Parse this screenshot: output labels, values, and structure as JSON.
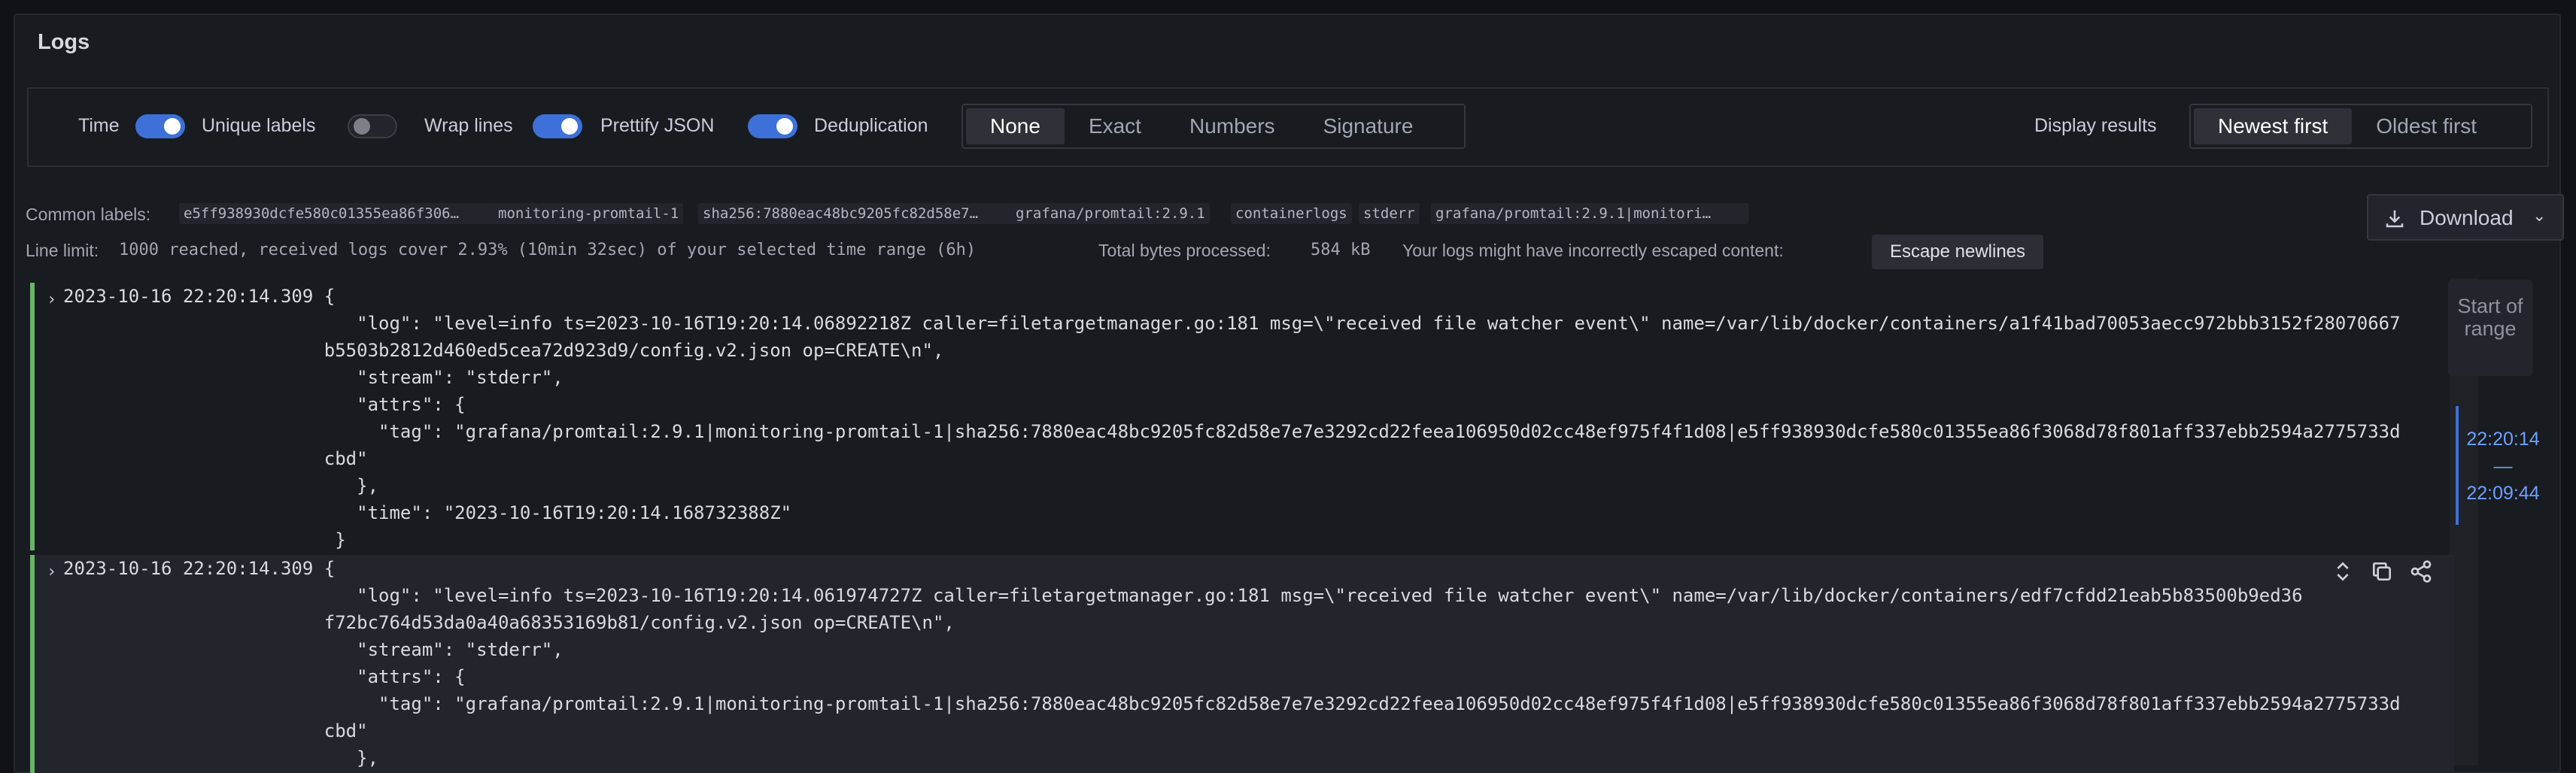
{
  "panel": {
    "title": "Logs"
  },
  "options": {
    "time_label": "Time",
    "unique_labels_label": "Unique labels",
    "wrap_lines_label": "Wrap lines",
    "prettify_json_label": "Prettify JSON",
    "dedup_label": "Deduplication",
    "dedup_options": [
      "None",
      "Exact",
      "Numbers",
      "Signature"
    ],
    "dedup_selected": "None",
    "display_results_label": "Display results",
    "order_options": [
      "Newest first",
      "Oldest first"
    ],
    "order_selected": "Newest first",
    "toggles": {
      "time": true,
      "unique_labels": false,
      "wrap_lines": true,
      "prettify_json": true
    }
  },
  "meta": {
    "common_labels_label": "Common labels:",
    "common_labels": [
      "e5ff938930dcfe580c01355ea86f306…",
      "monitoring-promtail-1",
      "sha256:7880eac48bc9205fc82d58e7…",
      "grafana/promtail:2.9.1",
      "containerlogs",
      "stderr",
      "grafana/promtail:2.9.1|monitori…"
    ],
    "line_limit_label": "Line limit:",
    "line_limit_value": "1000 reached, received logs cover 2.93% (10min 32sec) of your selected time range (6h)",
    "bytes_label": "Total bytes processed:",
    "bytes_value": "584 kB",
    "escape_warning": "Your logs might have incorrectly escaped content:",
    "escape_button": "Escape newlines",
    "download_label": "Download"
  },
  "logs": [
    {
      "lines": [
        "2023-10-16 22:20:14.309 {",
        "                           \"log\": \"level=info ts=2023-10-16T19:20:14.06892218Z caller=filetargetmanager.go:181 msg=\\\"received file watcher event\\\" name=/var/lib/docker/containers/a1f41bad70053aecc972bbb3152f28070667",
        "                        b5503b2812d460ed5cea72d923d9/config.v2.json op=CREATE\\n\",",
        "                           \"stream\": \"stderr\",",
        "                           \"attrs\": {",
        "                             \"tag\": \"grafana/promtail:2.9.1|monitoring-promtail-1|sha256:7880eac48bc9205fc82d58e7e7e3292cd22feea106950d02cc48ef975f4f1d08|e5ff938930dcfe580c01355ea86f3068d78f801aff337ebb2594a2775733d",
        "                        cbd\"",
        "                           },",
        "                           \"time\": \"2023-10-16T19:20:14.168732388Z\"",
        "                         }"
      ]
    },
    {
      "lines": [
        "2023-10-16 22:20:14.309 {",
        "                           \"log\": \"level=info ts=2023-10-16T19:20:14.061974727Z caller=filetargetmanager.go:181 msg=\\\"received file watcher event\\\" name=/var/lib/docker/containers/edf7cfdd21eab5b83500b9ed36",
        "                        f72bc764d53da0a40a68353169b81/config.v2.json op=CREATE\\n\",",
        "                           \"stream\": \"stderr\",",
        "                           \"attrs\": {",
        "                             \"tag\": \"grafana/promtail:2.9.1|monitoring-promtail-1|sha256:7880eac48bc9205fc82d58e7e7e3292cd22feea106950d02cc48ef975f4f1d08|e5ff938930dcfe580c01355ea86f3068d78f801aff337ebb2594a2775733d",
        "                        cbd\"",
        "                           },"
      ]
    }
  ],
  "range": {
    "start_label": "Start of range",
    "from": "22:20:14",
    "dash": "—",
    "to": "22:09:44"
  },
  "colors": {
    "accent": "#3d71d9",
    "log_level_bar": "#6ab46a"
  }
}
